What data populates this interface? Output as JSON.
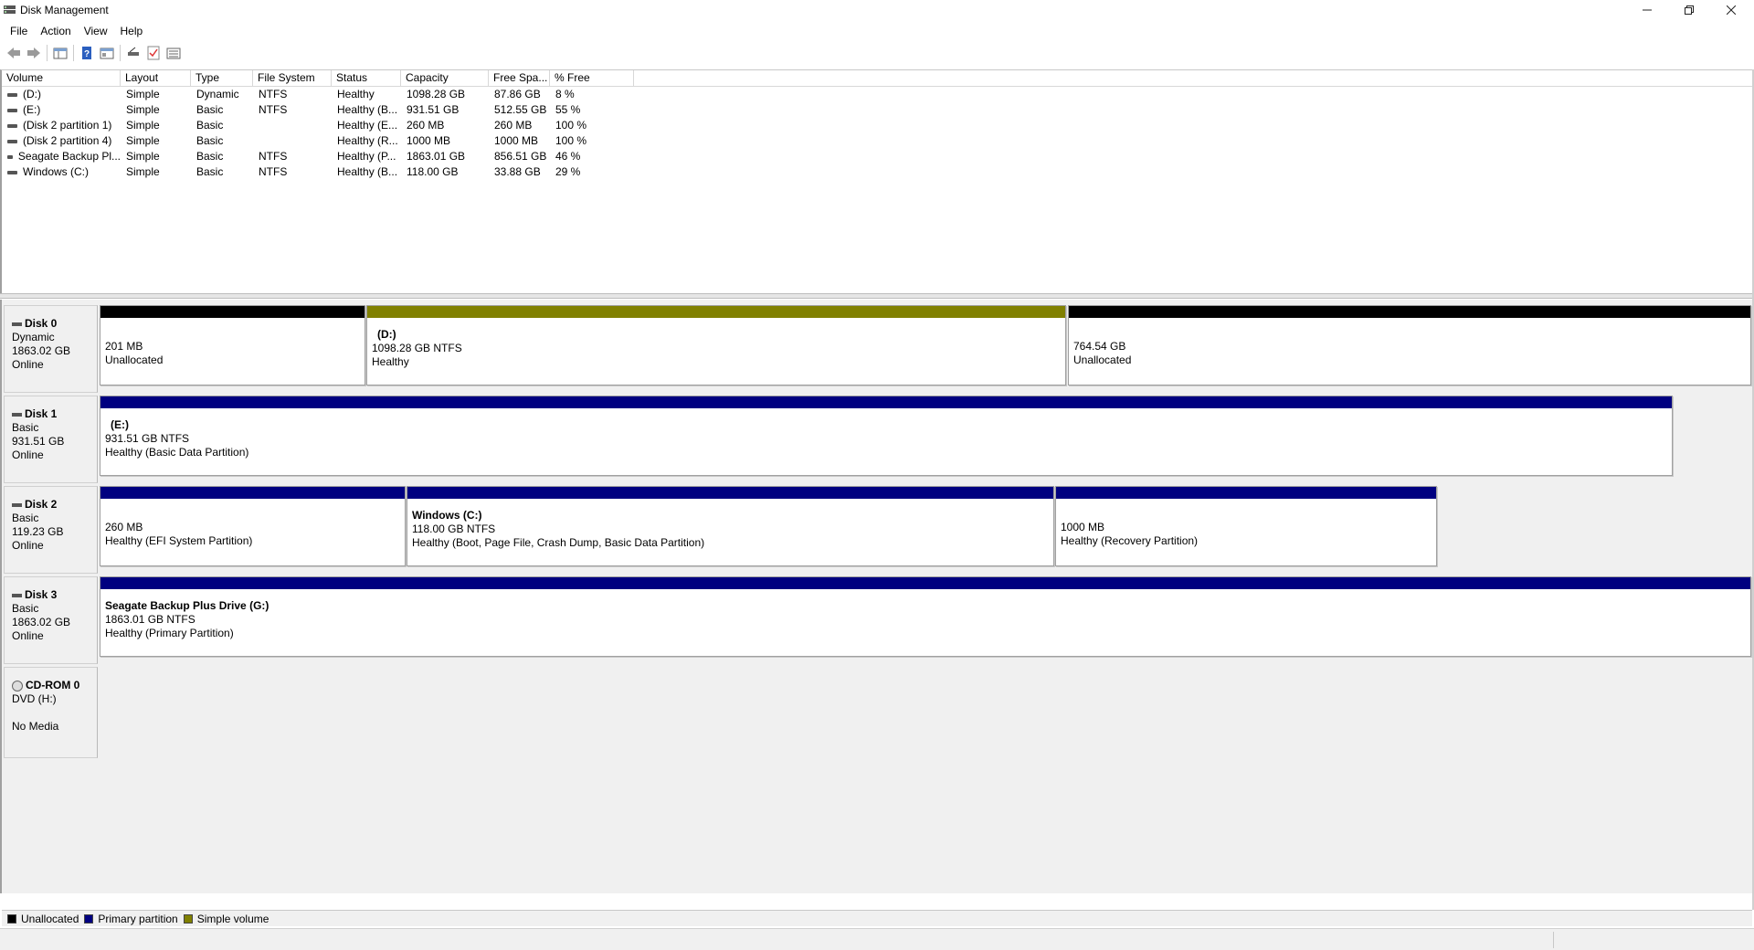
{
  "window": {
    "title": "Disk Management"
  },
  "menu": [
    {
      "label": "File"
    },
    {
      "label": "Action"
    },
    {
      "label": "View"
    },
    {
      "label": "Help"
    }
  ],
  "toolbar": [
    "back-icon",
    "forward-icon",
    "console-tree-icon",
    "help-icon",
    "properties-icon",
    "connect-icon",
    "check-icon",
    "list-icon"
  ],
  "volume_list": {
    "columns": [
      "Volume",
      "Layout",
      "Type",
      "File System",
      "Status",
      "Capacity",
      "Free Spa...",
      "% Free"
    ],
    "rows": [
      [
        "(D:)",
        "Simple",
        "Dynamic",
        "NTFS",
        "Healthy",
        "1098.28 GB",
        "87.86 GB",
        "8 %"
      ],
      [
        "(E:)",
        "Simple",
        "Basic",
        "NTFS",
        "Healthy (B...",
        "931.51 GB",
        "512.55 GB",
        "55 %"
      ],
      [
        "(Disk 2 partition 1)",
        "Simple",
        "Basic",
        "",
        "Healthy (E...",
        "260 MB",
        "260 MB",
        "100 %"
      ],
      [
        "(Disk 2 partition 4)",
        "Simple",
        "Basic",
        "",
        "Healthy (R...",
        "1000 MB",
        "1000 MB",
        "100 %"
      ],
      [
        "Seagate Backup Pl...",
        "Simple",
        "Basic",
        "NTFS",
        "Healthy (P...",
        "1863.01 GB",
        "856.51 GB",
        "46 %"
      ],
      [
        "Windows (C:)",
        "Simple",
        "Basic",
        "NTFS",
        "Healthy (B...",
        "118.00 GB",
        "33.88 GB",
        "29 %"
      ]
    ]
  },
  "disks": [
    {
      "name": "Disk 0",
      "type": "Dynamic",
      "size": "1863.02 GB",
      "state": "Online",
      "partitions": [
        {
          "name": "",
          "size": "201 MB",
          "status": "Unallocated",
          "color": "#000000"
        },
        {
          "name": "(D:)",
          "size": "1098.28 GB NTFS",
          "status": "Healthy",
          "color": "#808000"
        },
        {
          "name": "",
          "size": "764.54 GB",
          "status": "Unallocated",
          "color": "#000000"
        }
      ]
    },
    {
      "name": "Disk 1",
      "type": "Basic",
      "size": "931.51 GB",
      "state": "Online",
      "partitions": [
        {
          "name": "(E:)",
          "size": "931.51 GB NTFS",
          "status": "Healthy (Basic Data Partition)",
          "color": "#000080"
        }
      ]
    },
    {
      "name": "Disk 2",
      "type": "Basic",
      "size": "119.23 GB",
      "state": "Online",
      "partitions": [
        {
          "name": "",
          "size": "260 MB",
          "status": "Healthy (EFI System Partition)",
          "color": "#000080"
        },
        {
          "name": "Windows  (C:)",
          "size": "118.00 GB NTFS",
          "status": "Healthy (Boot, Page File, Crash Dump, Basic Data Partition)",
          "color": "#000080"
        },
        {
          "name": "",
          "size": "1000 MB",
          "status": "Healthy (Recovery Partition)",
          "color": "#000080"
        }
      ]
    },
    {
      "name": "Disk 3",
      "type": "Basic",
      "size": "1863.02 GB",
      "state": "Online",
      "partitions": [
        {
          "name": "Seagate Backup Plus Drive  (G:)",
          "size": "1863.01 GB NTFS",
          "status": "Healthy (Primary Partition)",
          "color": "#000080"
        }
      ]
    }
  ],
  "cdrom": {
    "name": "CD-ROM 0",
    "type": "DVD (H:)",
    "state": "No Media"
  },
  "legend": [
    {
      "label": "Unallocated",
      "color": "#000000"
    },
    {
      "label": "Primary partition",
      "color": "#000080"
    },
    {
      "label": "Simple volume",
      "color": "#808000"
    }
  ]
}
